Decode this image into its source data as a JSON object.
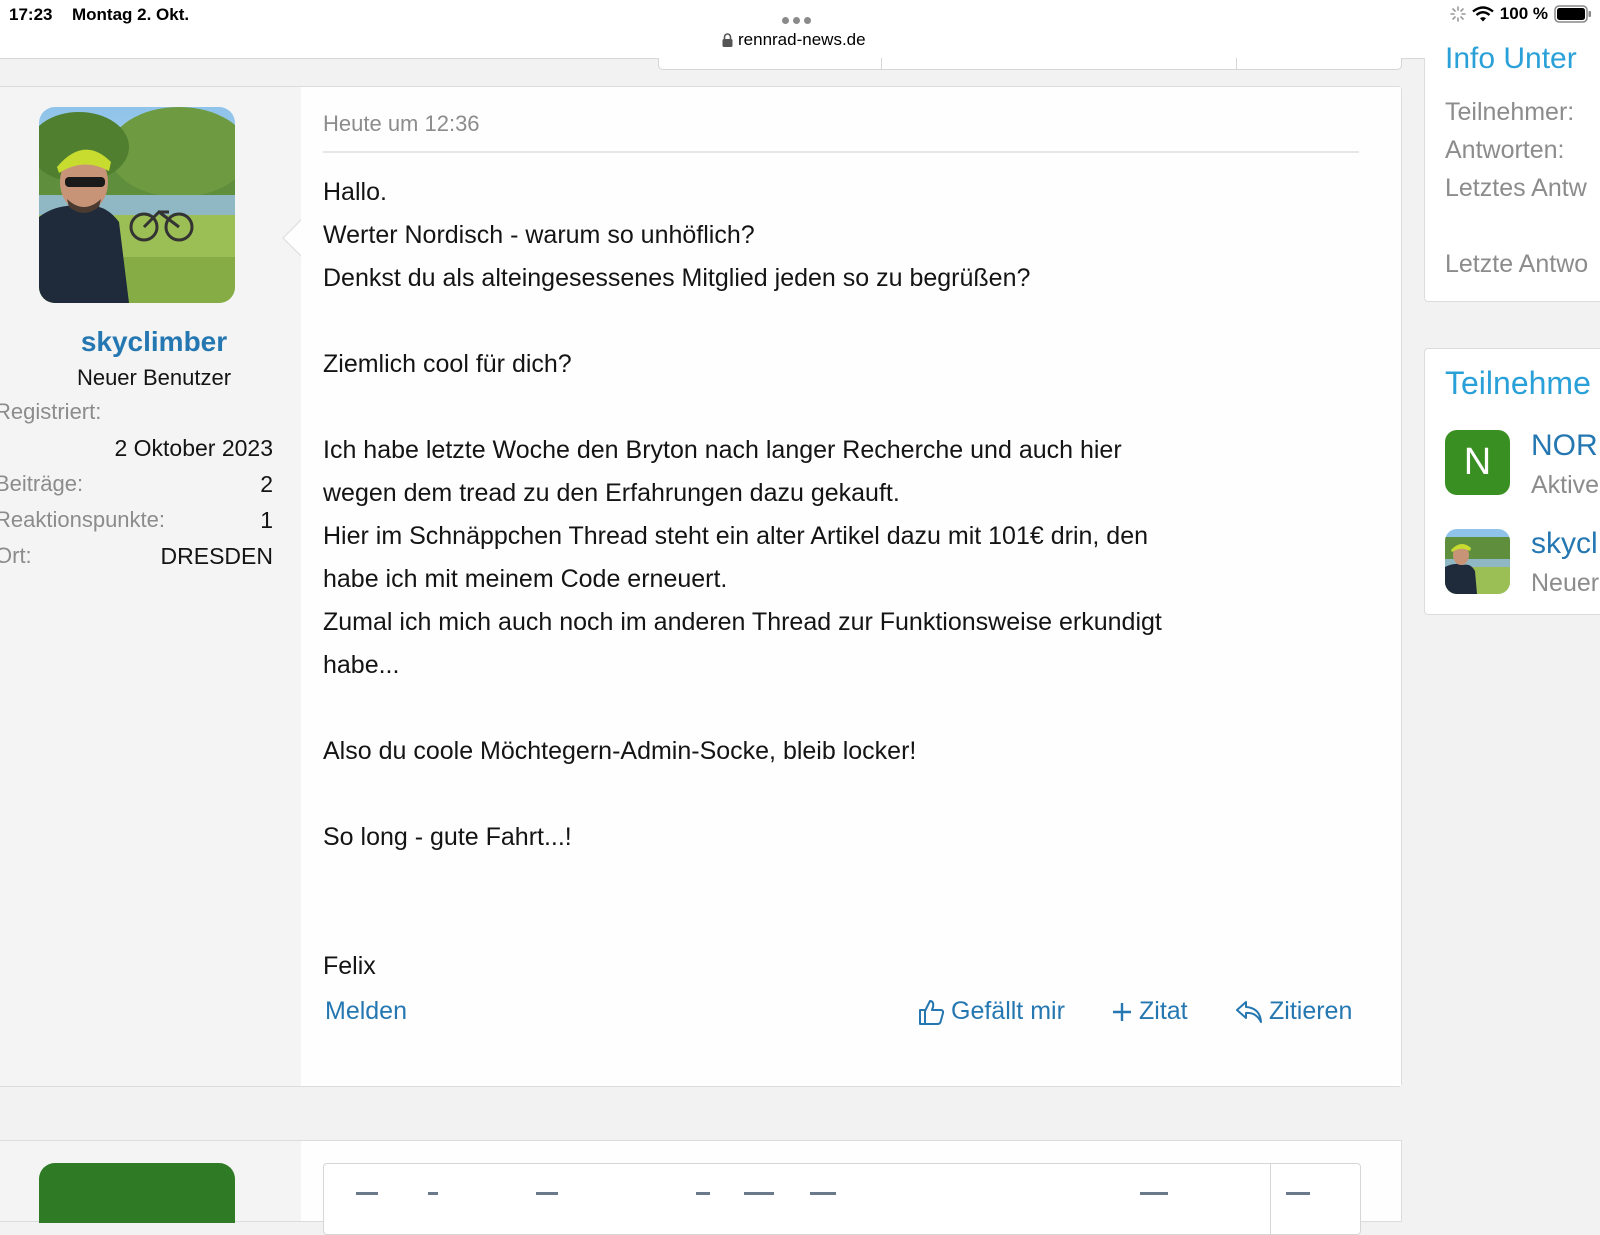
{
  "statusbar": {
    "time": "17:23",
    "date": "Montag 2. Okt.",
    "url": "rennrad-news.de",
    "battery": "100 %"
  },
  "post": {
    "user": {
      "name": "skyclimber",
      "title": "Neuer Benutzer",
      "registered_label": "Registriert:",
      "registered_value": "2 Oktober 2023",
      "posts_label": "Beiträge:",
      "posts_value": "2",
      "reactions_label": "Reaktionspunkte:",
      "reactions_value": "1",
      "location_label": "Ort:",
      "location_value": "DRESDEN"
    },
    "date": "Heute um 12:36",
    "body": [
      "Hallo.",
      "Werter Nordisch - warum so unhöflich?",
      "Denkst du als alteingesessenes Mitglied jeden so zu begrüßen?",
      "",
      "Ziemlich cool für dich?",
      "",
      "Ich habe letzte Woche den Bryton nach langer Recherche und auch hier",
      "wegen dem tread zu den Erfahrungen dazu gekauft.",
      "Hier im Schnäppchen Thread steht ein alter Artikel dazu mit 101€ drin, den",
      "habe ich mit meinem Code erneuert.",
      "Zumal ich mich auch noch im anderen Thread zur Funktionsweise erkundigt",
      "habe...",
      "",
      "Also du coole Möchtegern-Admin-Socke, bleib locker!",
      "",
      "So long - gute Fahrt...!",
      "",
      "",
      "Felix"
    ],
    "actions": {
      "report": "Melden",
      "like": "Gefällt mir",
      "quote_add": "Zitat",
      "reply": "Zitieren"
    }
  },
  "sidebar": {
    "info": {
      "title_cut": "Info Unter",
      "participants_label": "Teilnehmer:",
      "replies_label": "Antworten:",
      "last_reply_label": "Letztes Antw",
      "last_reply2_label": "Letzte Antwo"
    },
    "participants": {
      "title": "Teilnehme",
      "items": [
        {
          "initial": "N",
          "name": "NORI",
          "title": "Aktive"
        },
        {
          "name": "skycl",
          "title": "Neuer"
        }
      ]
    }
  },
  "colors": {
    "link": "#2577b1",
    "accent_title": "#2aa0d8",
    "avatar_green": "#3a8f22"
  }
}
